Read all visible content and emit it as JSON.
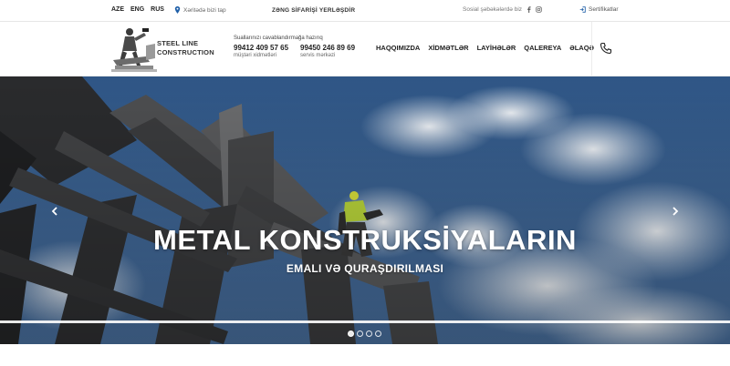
{
  "topbar": {
    "languages": [
      "AZE",
      "ENG",
      "RUS"
    ],
    "location": "Xəritədə bizi tap",
    "callback": "ZƏNG SİFARİŞİ YERLƏŞDİR",
    "social_text": "Sosial şəbəkələrdə biz",
    "certificates": "Sertifikatlar"
  },
  "header": {
    "brand_line1": "STEEL LINE",
    "brand_line2": "CONSTRUCTION",
    "contact_heading": "Suallarınızı cavablandırmağa hazırıq",
    "phone1": "99412 409 57 65",
    "phone1_label": "müştəri xidmətləri",
    "phone2": "99450 246 89 69",
    "phone2_label": "servis mərkəzi",
    "nav": [
      "HAQQIMIZDA",
      "XİDMƏTLƏR",
      "LAYİHƏLƏR",
      "QALEREYA",
      "ƏLAQƏ"
    ]
  },
  "hero": {
    "title": "METAL KONSTRUKSİYALARIN",
    "subtitle": "EMALI VƏ QURAŞDIRILMASI",
    "slide_count": 4,
    "active_slide": 1,
    "progress": 1.0
  },
  "colors": {
    "sky": "#3b5f8e",
    "steel": "#5c5c5c",
    "text_dark": "#222222"
  },
  "icons": [
    "map-pin-icon",
    "facebook-icon",
    "instagram-icon",
    "login-icon",
    "phone-icon",
    "chevron-left-icon",
    "chevron-right-icon"
  ]
}
